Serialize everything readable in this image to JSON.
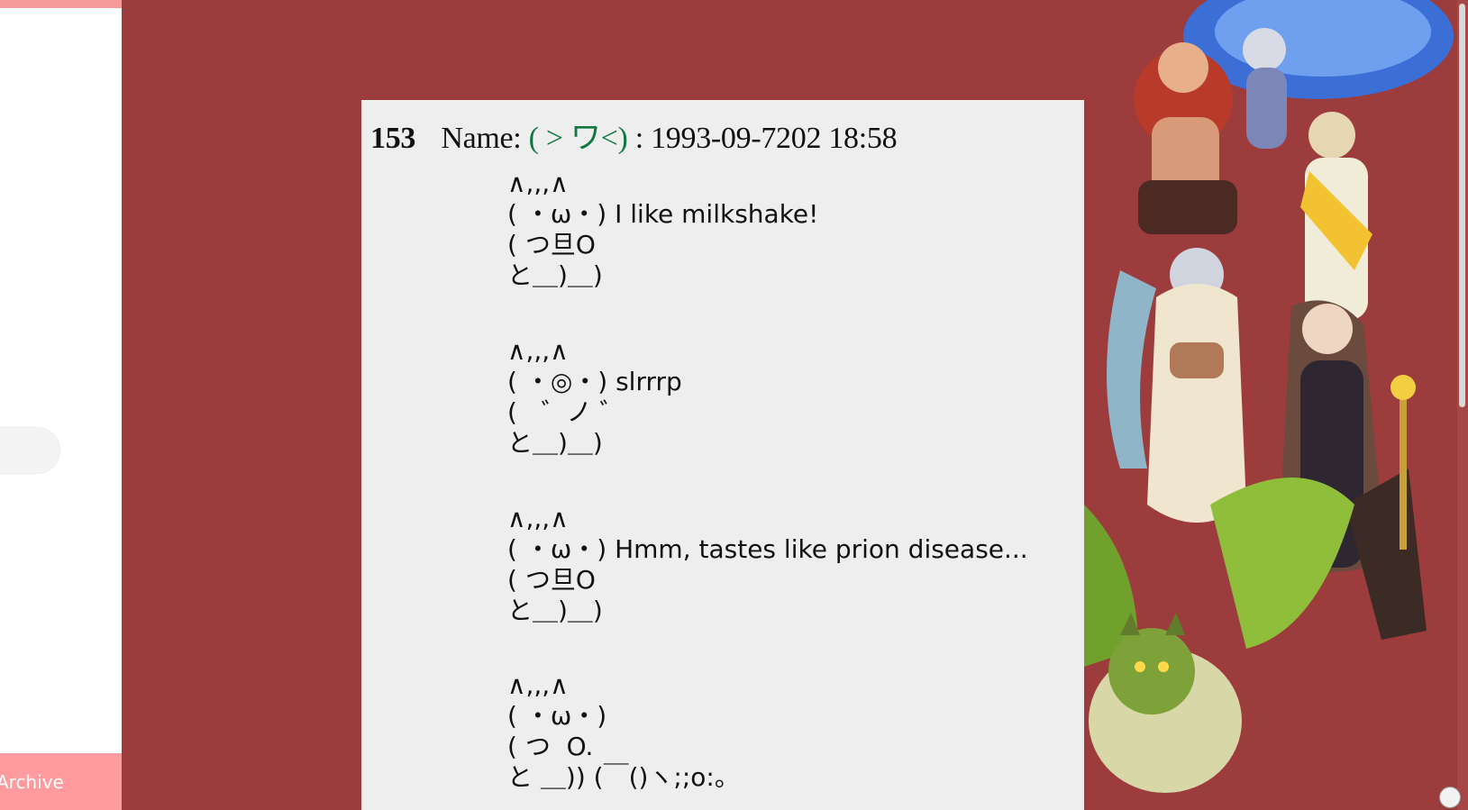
{
  "sidebar": {
    "archive_label": "Archive"
  },
  "post": {
    "number": "153",
    "name_label": "Name:",
    "name": "( > ワ<)",
    "datetime": ": 1993-09-7202 18:58",
    "art_lines": [
      {
        "text": "∧,,,∧\n( ・ω・) I like milkshake!\n( つ旦O\nと＿)＿)"
      },
      {
        "text": "∧,,,∧\n( ・◎・) slrrrp\n(   ゛ノ ゛\nと＿)＿)"
      },
      {
        "text": "∧,,,∧\n( ・ω・) Hmm, tastes like prion disease...\n( つ旦O\nと＿)＿)"
      },
      {
        "text": "∧,,,∧\n( ・ω・)\n( つ  O.\nと ＿)) (￣()ヽ;;o:。"
      }
    ]
  },
  "colors": {
    "background": "#9c3c3c",
    "post_bg": "#eeeeee",
    "name_color": "#117743",
    "archive_button": "#ff9a9f"
  },
  "icons": [
    "character-artwork"
  ]
}
